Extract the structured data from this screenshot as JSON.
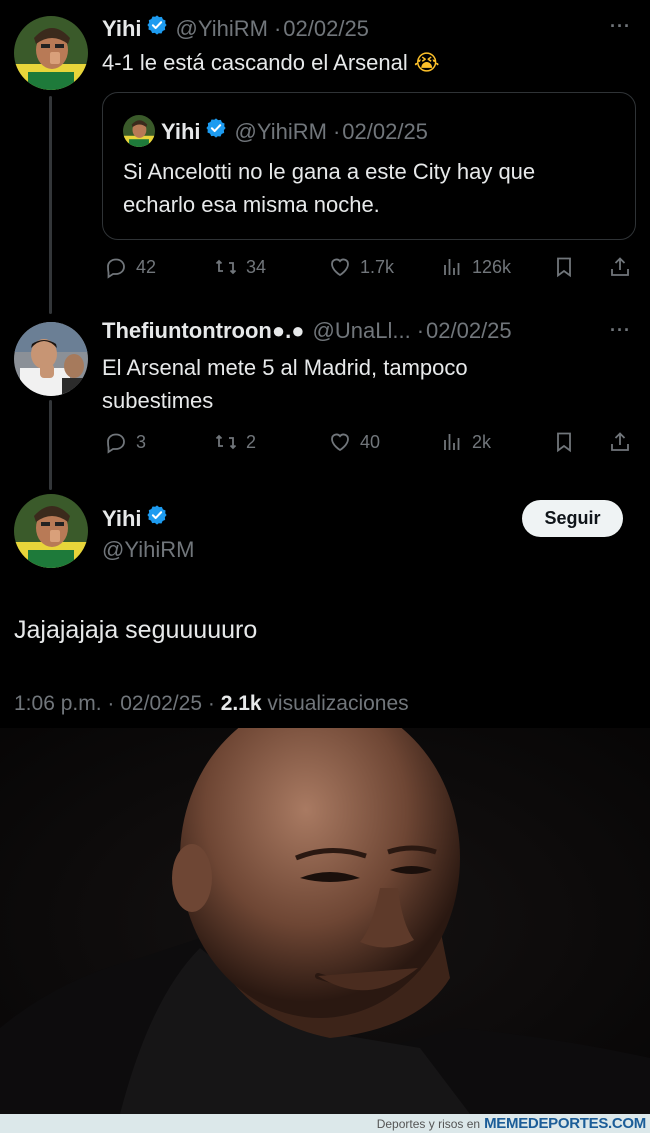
{
  "tweet1": {
    "name": "Yihi",
    "handle": "@YihiRM",
    "sep": "·",
    "date": "02/02/25",
    "text": "4-1 le está cascando el Arsenal",
    "emoji": "😭",
    "more": "···",
    "quote": {
      "name": "Yihi",
      "handle": "@YihiRM",
      "sep": "·",
      "date": "02/02/25",
      "text_line1": "Si Ancelotti no le gana a este City hay que",
      "text_line2": "echarlo esa misma noche."
    },
    "stats": {
      "replies": "42",
      "retweets": "34",
      "likes": "1.7k",
      "views": "126k"
    }
  },
  "tweet2": {
    "name": "Thefiuntontroon●.●",
    "handle": "@UnaLl...",
    "sep": "·",
    "date": "02/02/25",
    "text_line1": "El Arsenal mete 5 al Madrid, tampoco",
    "text_line2": "subestimes",
    "more": "···",
    "stats": {
      "replies": "3",
      "retweets": "2",
      "likes": "40",
      "views": "2k"
    }
  },
  "main_tweet": {
    "name": "Yihi",
    "handle": "@YihiRM",
    "follow_label": "Seguir",
    "text": "Jajajajaja seguuuuuro",
    "time": "1:06 p.m.",
    "sep1": "·",
    "date": "02/02/25",
    "sep2": "·",
    "views_count": "2.1k",
    "views_label": "visualizaciones"
  },
  "footer": {
    "tagline": "Deportes y risos en",
    "brand": "MEMEDEPORTES.COM"
  },
  "colors": {
    "background": "#000000",
    "verified_blue": "#1d9bf0",
    "muted": "#71767b",
    "text": "#e7e9ea"
  },
  "icons": [
    "verified-icon",
    "reply-icon",
    "retweet-icon",
    "like-icon",
    "views-icon",
    "bookmark-icon",
    "share-icon",
    "more-icon"
  ]
}
